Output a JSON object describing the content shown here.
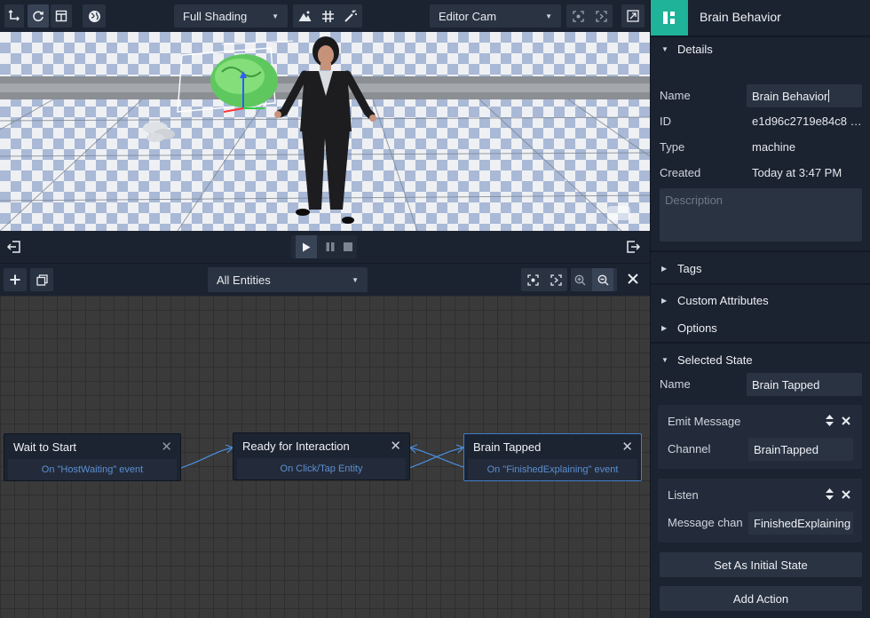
{
  "viewport": {
    "shading": "Full Shading",
    "camera": "Editor Cam"
  },
  "graph": {
    "filter": "All Entities",
    "nodes": [
      {
        "title": "Wait to Start",
        "event": "On \"HostWaiting\" event"
      },
      {
        "title": "Ready for Interaction",
        "event": "On Click/Tap Entity"
      },
      {
        "title": "Brain Tapped",
        "event": "On \"FinishedExplaining\" event"
      }
    ]
  },
  "panel": {
    "title": "Brain Behavior",
    "details": {
      "header": "Details",
      "name_label": "Name",
      "name_value": "Brain Behavior",
      "id_label": "ID",
      "id_value": "e1d96c2719e84c8 …",
      "type_label": "Type",
      "type_value": "machine",
      "created_label": "Created",
      "created_value": "Today at 3:47 PM",
      "description_placeholder": "Description"
    },
    "sections": {
      "tags": "Tags",
      "custom_attributes": "Custom Attributes",
      "options": "Options",
      "selected_state": "Selected State"
    },
    "selected_state": {
      "name_label": "Name",
      "name_value": "Brain Tapped",
      "emit": {
        "title": "Emit Message",
        "channel_label": "Channel",
        "channel_value": "BrainTapped"
      },
      "listen": {
        "title": "Listen",
        "channel_label": "Message chan",
        "channel_value": "FinishedExplaining"
      },
      "set_initial": "Set As Initial State",
      "add_action": "Add Action"
    }
  },
  "colors": {
    "accent": "#1fb39a",
    "link_blue": "#5b8fd1",
    "panel_bg": "#1b2230",
    "control_bg": "#2a3342"
  },
  "icons": [
    "axis-icon",
    "refresh-icon",
    "layout-icon",
    "globe-icon",
    "terrain-icon",
    "grid-icon",
    "magic-wand-icon",
    "focus-icon",
    "frame-icon",
    "maximize-icon",
    "exit-left-icon",
    "play-icon",
    "pause-icon",
    "stop-icon",
    "exit-right-icon",
    "add-icon",
    "duplicate-icon",
    "zoom-in-icon",
    "zoom-out-icon",
    "close-icon",
    "logo-icon"
  ]
}
